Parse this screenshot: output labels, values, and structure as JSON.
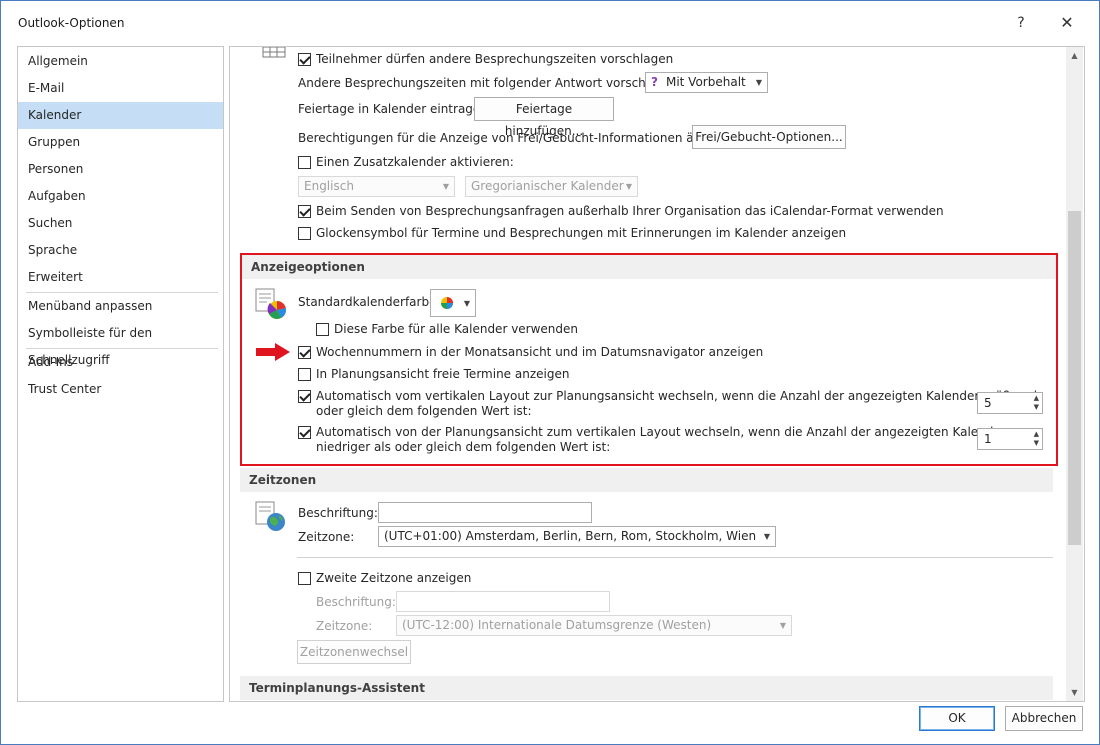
{
  "window": {
    "title": "Outlook-Optionen",
    "help_glyph": "?",
    "close_glyph": "✕"
  },
  "sidebar": {
    "items": [
      {
        "label": "Allgemein"
      },
      {
        "label": "E-Mail"
      },
      {
        "label": "Kalender",
        "selected": true
      },
      {
        "label": "Gruppen"
      },
      {
        "label": "Personen"
      },
      {
        "label": "Aufgaben"
      },
      {
        "label": "Suchen"
      },
      {
        "label": "Sprache"
      },
      {
        "label": "Erweitert"
      },
      {
        "label": "Menüband anpassen"
      },
      {
        "label": "Symbolleiste für den Schnellzugriff"
      },
      {
        "label": "Add-Ins"
      },
      {
        "label": "Trust Center"
      }
    ]
  },
  "meetings": {
    "allow_other_times": {
      "label": "Teilnehmer dürfen andere Besprechungszeiten vorschlagen",
      "checked": true
    },
    "propose_response": {
      "label": "Andere Besprechungszeiten mit folgender Antwort vorschlagen:",
      "value": "Mit Vorbehalt",
      "icon": "question-mark-icon"
    },
    "holidays": {
      "label": "Feiertage in Kalender eintragen:",
      "button": "Feiertage hinzufügen..."
    },
    "freebusy": {
      "label": "Berechtigungen für die Anzeige von Frei/Gebucht-Informationen ändern:",
      "button": "Frei/Gebucht-Optionen..."
    },
    "alt_calendar": {
      "label": "Einen Zusatzkalender aktivieren:",
      "checked": false,
      "language": "Englisch",
      "calendar_type": "Gregorianischer Kalender"
    },
    "icalendar": {
      "label": "Beim Senden von Besprechungsanfragen außerhalb Ihrer Organisation das iCalendar-Format verwenden",
      "checked": true
    },
    "bell_icon": {
      "label": "Glockensymbol für Termine und Besprechungen mit Erinnerungen im Kalender anzeigen",
      "checked": false
    }
  },
  "display_options": {
    "header": "Anzeigeoptionen",
    "default_color_label": "Standardkalenderfarbe:",
    "same_color_all": {
      "label": "Diese Farbe für alle Kalender verwenden",
      "checked": false
    },
    "week_numbers": {
      "label": "Wochennummern in der Monatsansicht und im Datumsnavigator anzeigen",
      "checked": true
    },
    "free_slots": {
      "label": "In Planungsansicht freie Termine anzeigen",
      "checked": false
    },
    "auto_switch_to_schedule": {
      "line1": "Automatisch vom vertikalen Layout zur Planungsansicht wechseln, wenn die Anzahl der angezeigten Kalender größer als",
      "line2": "oder gleich dem folgenden Wert ist:",
      "checked": true,
      "value": "5"
    },
    "auto_switch_to_vertical": {
      "line1": "Automatisch von der Planungsansicht zum vertikalen Layout wechseln, wenn die Anzahl der angezeigten Kalender",
      "line2": "niedriger als oder gleich dem folgenden Wert ist:",
      "checked": true,
      "value": "1"
    }
  },
  "timezones": {
    "header": "Zeitzonen",
    "caption_label": "Beschriftung:",
    "caption_value": "",
    "zone_label": "Zeitzone:",
    "zone_value": "(UTC+01:00) Amsterdam, Berlin, Bern, Rom, Stockholm, Wien",
    "second_zone": {
      "label": "Zweite Zeitzone anzeigen",
      "checked": false
    },
    "second_caption_label": "Beschriftung:",
    "second_zone_label": "Zeitzone:",
    "second_zone_value": "(UTC-12:00) Internationale Datumsgrenze (Westen)",
    "swap_button": "Zeitzonenwechsel"
  },
  "scheduling_assistant": {
    "header": "Terminplanungs-Assistent"
  },
  "footer": {
    "ok": "OK",
    "cancel": "Abbrechen"
  },
  "colors": {
    "highlight_box": "#e0141e",
    "selected_nav": "#c5def5",
    "arrow": "#e0141e"
  }
}
